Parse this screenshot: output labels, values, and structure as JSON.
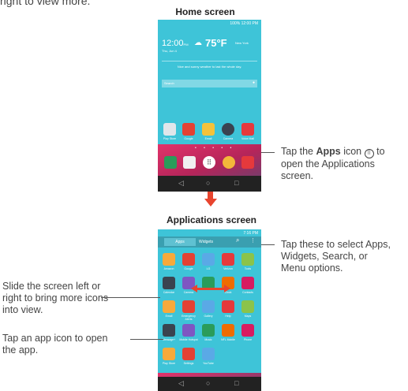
{
  "top_text": "right to view more.",
  "home": {
    "heading": "Home screen",
    "status": "100% 12:00 PM",
    "time": "12:00",
    "ampm": "PM",
    "date": "Thu, Jun 4",
    "temp": "75°F",
    "city": "New York",
    "weather": "Nice and sunny weather to last the whole day.",
    "search_placeholder": "Search",
    "apps": [
      "Play Store",
      "Google",
      "Email",
      "Camera",
      "Voice Mail"
    ]
  },
  "callout_apps": {
    "pre": "Tap the ",
    "bold": "Apps",
    "post": " icon",
    "line2": " to",
    "line3": "open the Applications",
    "line4": "screen."
  },
  "apps_screen": {
    "heading": "Applications screen",
    "status": "7:16 PM",
    "tab_apps": "Apps",
    "tab_widgets": "Widgets",
    "grid": [
      [
        "Amazon",
        "Google",
        "LG",
        "Verizon",
        "Tools"
      ],
      [
        "Calendar",
        "Camera",
        "",
        "Clock",
        "Contacts"
      ],
      [
        "Email",
        "Emergency Alerts",
        "Gallery",
        "Help",
        "Maps"
      ],
      [
        "Message+",
        "Mobile Hotspot",
        "Music",
        "NFL Mobile",
        "Phone"
      ],
      [
        "Play Store",
        "Settings",
        "YouTube",
        "",
        ""
      ]
    ]
  },
  "callout_tabs": [
    "Tap these to select Apps,",
    "Widgets, Search, or",
    "Menu options."
  ],
  "callout_slide": [
    "Slide the screen left or",
    "right to bring more icons",
    "into view."
  ],
  "callout_tap": [
    "Tap an app icon to open",
    "the app."
  ],
  "colors": {
    "phone_bg": "#3ec4d8",
    "arrow": "#e8442e",
    "pink": "#e2336a"
  }
}
